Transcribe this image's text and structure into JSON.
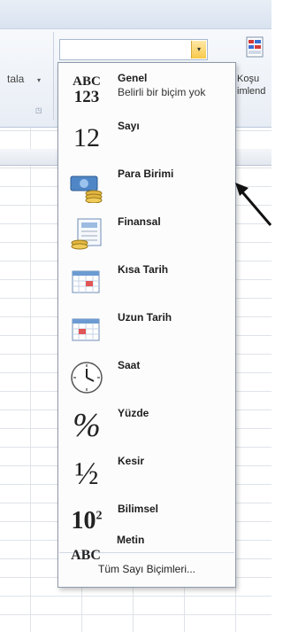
{
  "ribbon": {
    "group_label": "tala",
    "dropdown_arrow": "▾",
    "launcher_glyph": "◳",
    "format_combo": {
      "value": "",
      "button_glyph": "▾"
    },
    "cond_format_label_1": "Koşu",
    "cond_format_label_2": "imlend"
  },
  "menu": {
    "items": [
      {
        "title": "Genel",
        "subtitle": "Belirli bir biçim yok",
        "icon": "abc123-icon",
        "glyph_top": "ABC",
        "glyph_bottom": "123"
      },
      {
        "title": "Sayı",
        "icon": "number-icon",
        "glyph": "12"
      },
      {
        "title": "Para Birimi",
        "icon": "currency-icon"
      },
      {
        "title": "Finansal",
        "icon": "financial-icon"
      },
      {
        "title": "Kısa Tarih",
        "icon": "short-date-icon"
      },
      {
        "title": "Uzun Tarih",
        "icon": "long-date-icon"
      },
      {
        "title": "Saat",
        "icon": "clock-icon"
      },
      {
        "title": "Yüzde",
        "icon": "percent-icon",
        "glyph": "%"
      },
      {
        "title": "Kesir",
        "icon": "fraction-icon",
        "glyph": "½"
      },
      {
        "title": "Bilimsel",
        "icon": "scientific-icon",
        "glyph": "10",
        "glyph_sup": "2"
      },
      {
        "title": "Metin",
        "icon": "text-icon",
        "glyph": "ABC"
      }
    ],
    "footer": "Tüm Sayı Biçimleri..."
  },
  "colors": {
    "menu_border": "#8e9aab",
    "combo_button": "#f8c94a",
    "arrow": "#111111"
  }
}
